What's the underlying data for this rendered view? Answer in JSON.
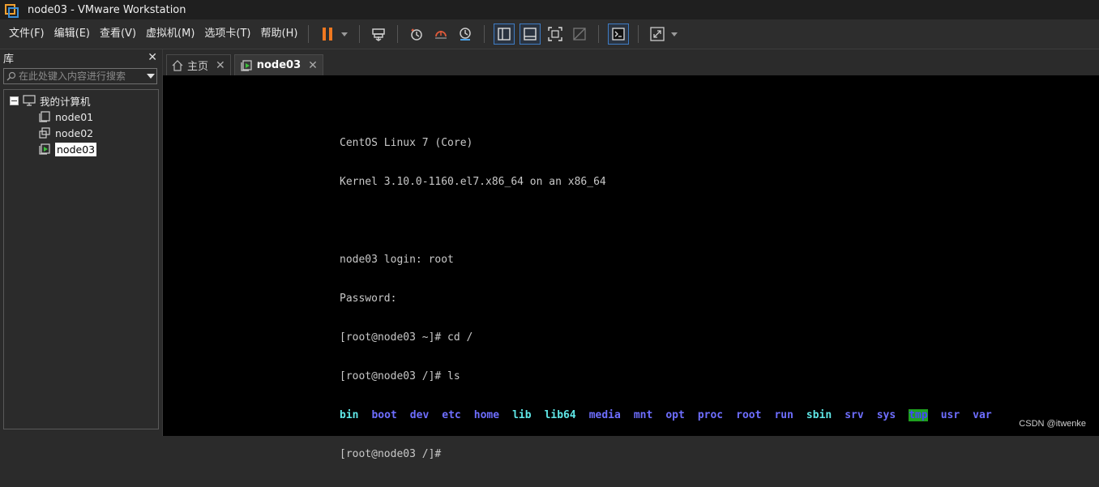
{
  "window": {
    "title": "node03 - VMware Workstation"
  },
  "menu": [
    "文件(F)",
    "编辑(E)",
    "查看(V)",
    "虚拟机(M)",
    "选项卡(T)",
    "帮助(H)"
  ],
  "library": {
    "title": "库",
    "search_placeholder": "在此处键入内容进行搜索",
    "root": "我的计算机",
    "vms": [
      "node01",
      "node02",
      "node03"
    ],
    "selected": "node03"
  },
  "tabs": [
    {
      "label": "主页",
      "active": false
    },
    {
      "label": "node03",
      "active": true
    }
  ],
  "console": {
    "lines": [
      "CentOS Linux 7 (Core)",
      "Kernel 3.10.0-1160.el7.x86_64 on an x86_64",
      "",
      "node03 login: root",
      "Password:",
      "[root@node03 ~]# cd /",
      "[root@node03 /]# ls"
    ],
    "ls_output": [
      {
        "name": "bin",
        "kind": "link"
      },
      {
        "name": "boot",
        "kind": "dir"
      },
      {
        "name": "dev",
        "kind": "dir"
      },
      {
        "name": "etc",
        "kind": "dir"
      },
      {
        "name": "home",
        "kind": "dir"
      },
      {
        "name": "lib",
        "kind": "link"
      },
      {
        "name": "lib64",
        "kind": "link"
      },
      {
        "name": "media",
        "kind": "dir"
      },
      {
        "name": "mnt",
        "kind": "dir"
      },
      {
        "name": "opt",
        "kind": "dir"
      },
      {
        "name": "proc",
        "kind": "dir"
      },
      {
        "name": "root",
        "kind": "dir"
      },
      {
        "name": "run",
        "kind": "dir"
      },
      {
        "name": "sbin",
        "kind": "link"
      },
      {
        "name": "srv",
        "kind": "dir"
      },
      {
        "name": "sys",
        "kind": "dir"
      },
      {
        "name": "tmp",
        "kind": "tmp"
      },
      {
        "name": "usr",
        "kind": "dir"
      },
      {
        "name": "var",
        "kind": "dir"
      }
    ],
    "prompt": "[root@node03 /]#"
  },
  "watermark": "CSDN @itwenke",
  "colors": {
    "accent_pause": "#f07820",
    "toolbar_button_border": "#3f7cc4",
    "ls_dir": "#6e6eff",
    "ls_link": "#5fe7e7",
    "ls_tmp_bg": "#1ea01e"
  },
  "icons": {
    "toolbar": [
      "pause-icon",
      "send-keys-icon",
      "snapshot-icon",
      "revert-snapshot-icon",
      "snapshot-manager-icon",
      "show-library-icon",
      "thumbnail-bar-icon",
      "full-screen-icon",
      "unity-icon",
      "console-view-icon",
      "stretch-icon"
    ]
  }
}
